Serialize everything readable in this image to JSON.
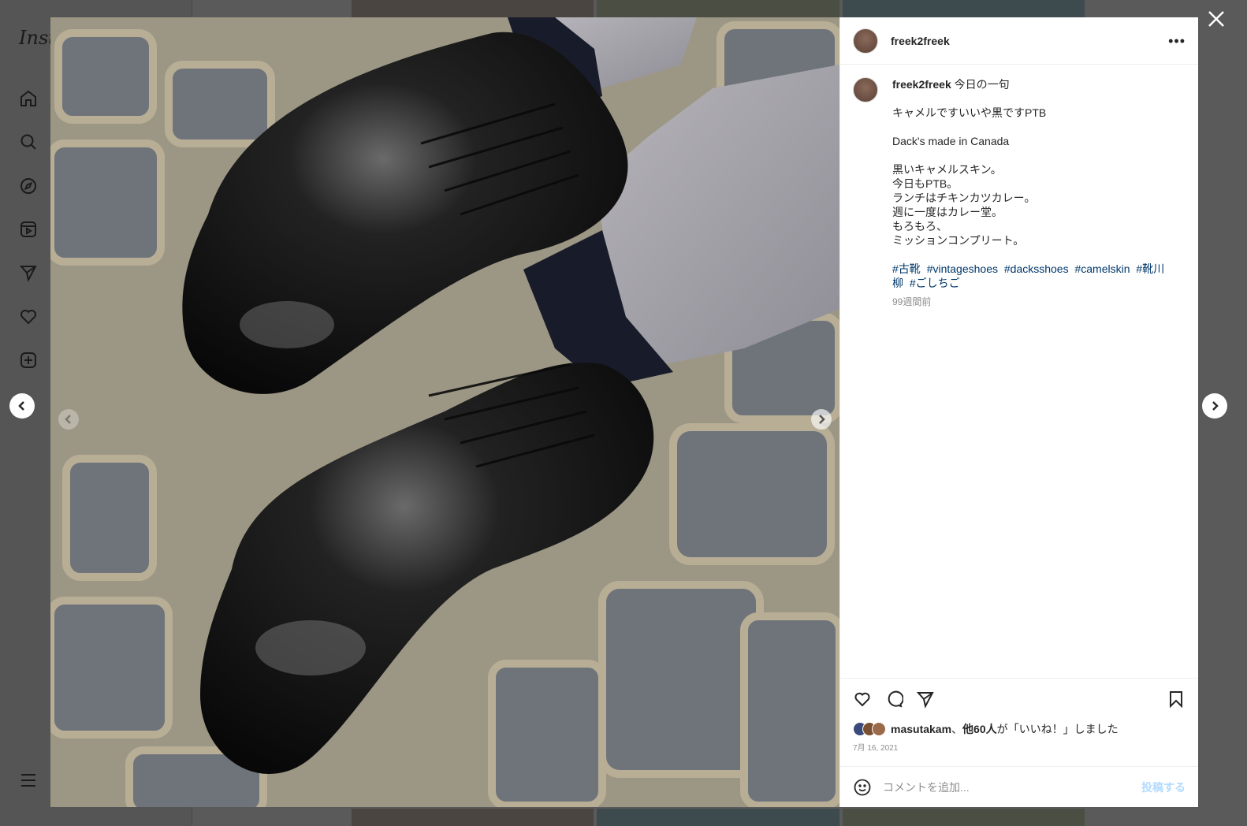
{
  "app": {
    "logo_text": "Inst"
  },
  "sidebar_icons": [
    "home-icon",
    "search-icon",
    "explore-icon",
    "reels-icon",
    "messages-icon",
    "notifications-icon",
    "create-icon",
    "menu-icon"
  ],
  "post": {
    "username": "freek2freek",
    "more_label": "•••",
    "caption_username": "freek2freek",
    "caption_title": "今日の一句",
    "caption_lines_1": [
      "キャメルですいいや黒ですPTB"
    ],
    "caption_lines_2": [
      "Dack's made in Canada"
    ],
    "caption_lines_3": [
      "黒いキャメルスキン。",
      "今日もPTB。",
      "ランチはチキンカツカレー。",
      "週に一度はカレー堂。",
      "もろもろ、",
      "ミッションコンプリート。"
    ],
    "hashtags": [
      "#古靴",
      "#vintageshoes",
      "#dacksshoes",
      "#camelskin",
      "#靴川柳",
      "#ごしちご"
    ],
    "time_ago": "99週間前",
    "likes_user": "masutakam",
    "likes_text_mid": "、",
    "likes_others": "他60人",
    "likes_suffix": "が「いいね！」しました",
    "date": "7月 16, 2021",
    "comment_placeholder": "コメントを追加...",
    "post_button": "投稿する"
  },
  "colors": {
    "hashtag": "#00376b",
    "post_button_disabled": "#b3dbff",
    "overlay": "#5a5a5a"
  }
}
